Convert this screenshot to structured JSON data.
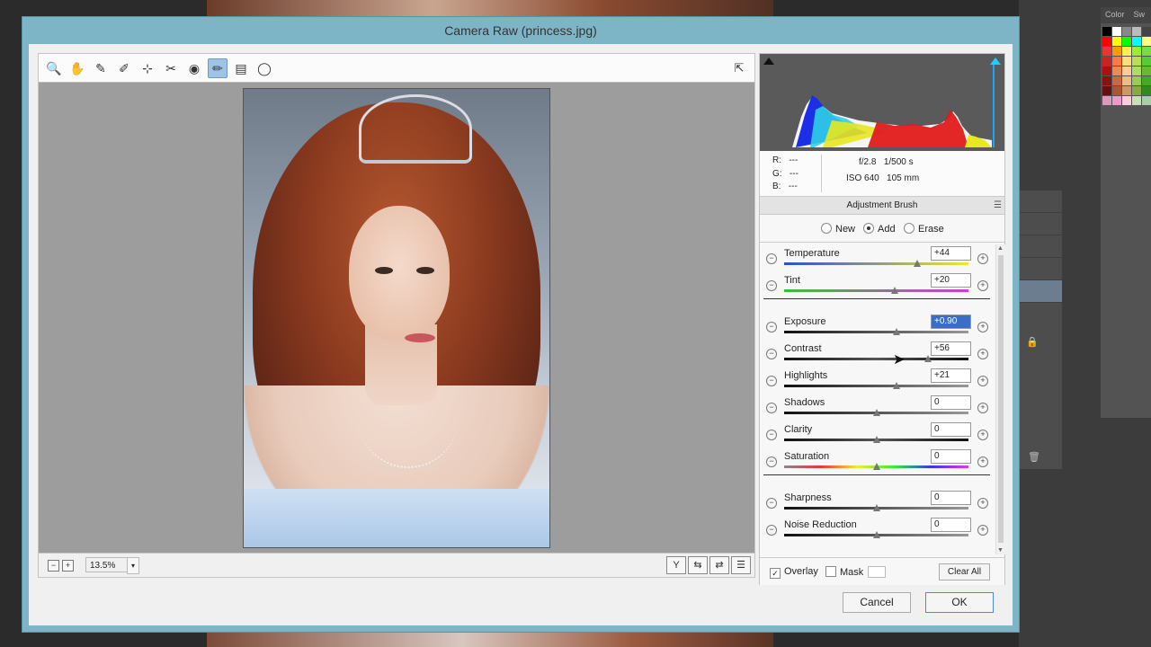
{
  "window_title": "Camera Raw (princess.jpg)",
  "background": {
    "color_panel_tabs": [
      "Color",
      "Sw"
    ]
  },
  "toolbar": {
    "tools": [
      {
        "icon": "zoom-icon",
        "glyph": "🔍"
      },
      {
        "icon": "hand-icon",
        "glyph": "✋"
      },
      {
        "icon": "white-balance-icon",
        "glyph": "✎"
      },
      {
        "icon": "color-sampler-icon",
        "glyph": "✐"
      },
      {
        "icon": "target-adjust-icon",
        "glyph": "⊹"
      },
      {
        "icon": "spot-removal-icon",
        "glyph": "✂"
      },
      {
        "icon": "red-eye-icon",
        "glyph": "◉"
      },
      {
        "icon": "adjustment-brush-icon",
        "glyph": "✏"
      },
      {
        "icon": "graduated-filter-icon",
        "glyph": "▤"
      },
      {
        "icon": "radial-filter-icon",
        "glyph": "◯"
      }
    ],
    "fullscreen_glyph": "⇱"
  },
  "preview": {
    "zoom_minus": "−",
    "zoom_plus": "+",
    "zoom_level": "13.5%",
    "zoom_dropdown": "▾",
    "view_buttons": [
      "Y",
      "⇆",
      "⇄",
      "☰"
    ]
  },
  "info": {
    "r_label": "R:",
    "r_value": "---",
    "g_label": "G:",
    "g_value": "---",
    "b_label": "B:",
    "b_value": "---",
    "aperture": "f/2.8",
    "shutter": "1/500 s",
    "iso": "ISO 640",
    "focal": "105 mm"
  },
  "panel": {
    "title": "Adjustment Brush",
    "menu_glyph": "☰",
    "modes": [
      {
        "label": "New",
        "selected": false
      },
      {
        "label": "Add",
        "selected": true
      },
      {
        "label": "Erase",
        "selected": false
      }
    ]
  },
  "sliders": [
    {
      "label": "Temperature",
      "value": "+44",
      "fraction": 0.72,
      "track": "linear-gradient(90deg,#2a4fd6,#f1e43a)",
      "selected": false
    },
    {
      "label": "Tint",
      "value": "+20",
      "fraction": 0.6,
      "track": "linear-gradient(90deg,#3bbf3b,#d23bd2)",
      "selected": false
    },
    {
      "label": "Exposure",
      "value": "+0.90",
      "fraction": 0.61,
      "track": "linear-gradient(90deg,#111,#999)",
      "selected": true
    },
    {
      "label": "Contrast",
      "value": "+56",
      "fraction": 0.78,
      "track": "linear-gradient(90deg,#111,#555,#111)",
      "selected": false
    },
    {
      "label": "Highlights",
      "value": "+21",
      "fraction": 0.61,
      "track": "linear-gradient(90deg,#111,#999)",
      "selected": false
    },
    {
      "label": "Shadows",
      "value": "0",
      "fraction": 0.5,
      "track": "linear-gradient(90deg,#111,#999)",
      "selected": false
    },
    {
      "label": "Clarity",
      "value": "0",
      "fraction": 0.5,
      "track": "linear-gradient(90deg,#111,#555,#111)",
      "selected": false
    },
    {
      "label": "Saturation",
      "value": "0",
      "fraction": 0.5,
      "track": "linear-gradient(90deg,#888,#e33,#ee3,#3e3,#33e,#e3e)",
      "selected": false
    },
    {
      "label": "Sharpness",
      "value": "0",
      "fraction": 0.5,
      "track": "linear-gradient(90deg,#111,#999)",
      "selected": false
    },
    {
      "label": "Noise Reduction",
      "value": "0",
      "fraction": 0.5,
      "track": "linear-gradient(90deg,#111,#999)",
      "selected": false
    }
  ],
  "options": {
    "overlay_label": "Overlay",
    "overlay_checked": true,
    "mask_label": "Mask",
    "mask_checked": false,
    "clear_all": "Clear All"
  },
  "buttons": {
    "cancel": "Cancel",
    "ok": "OK"
  },
  "colors": {
    "dialog_frame": "#7eb5c6",
    "selection": "#3a6ec4",
    "active_tool": "#9fc3e6"
  }
}
